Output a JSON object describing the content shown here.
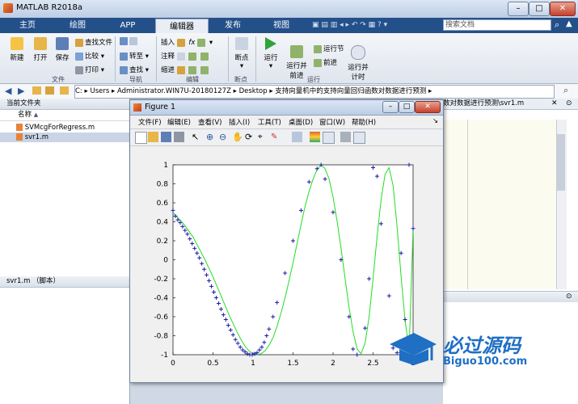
{
  "app": {
    "title": "MATLAB R2018a",
    "window_buttons": [
      "–",
      "□",
      "✕"
    ]
  },
  "tabs": [
    {
      "label": "主页"
    },
    {
      "label": "绘图"
    },
    {
      "label": "APP"
    },
    {
      "label": "编辑器",
      "active": true
    },
    {
      "label": "发布"
    },
    {
      "label": "视图"
    }
  ],
  "search": {
    "placeholder": "搜索文档"
  },
  "ribbon": {
    "file_group": "文件",
    "nav_group": "导航",
    "edit_group": "编辑",
    "breakpoint_group": "断点",
    "run_group": "运行",
    "new": "新建",
    "open": "打开",
    "save": "保存",
    "find_files": "查找文件",
    "compare": "比较",
    "print": "打印",
    "goto": "转至",
    "find": "查找",
    "insert": "插入",
    "comment": "注释",
    "indent": "缩进",
    "fx": "fx",
    "breakpoints": "断点",
    "run": "运行",
    "run_advance": "运行并\n前进",
    "run_section": "运行节",
    "advance": "前进",
    "run_time": "运行并\n计时"
  },
  "address": {
    "segments": [
      "C:",
      "Users",
      "Administrator.WIN7U-20180127Z",
      "Desktop",
      "支持向量机中的支持向量回归函数对数据进行预测"
    ]
  },
  "current_folder": {
    "header": "当前文件夹",
    "column_name": "名称",
    "column_sort": "▲",
    "files": [
      {
        "name": "SVMcgForRegress.m",
        "selected": false
      },
      {
        "name": "svr1.m",
        "selected": true
      }
    ],
    "details_header": "svr1.m （脚本）"
  },
  "editor_tab_text": "数对数据进行预测\\svr1.m",
  "figure": {
    "title": "Figure 1",
    "menus": [
      "文件(F)",
      "编辑(E)",
      "查看(V)",
      "插入(I)",
      "工具(T)",
      "桌面(D)",
      "窗口(W)",
      "帮助(H)"
    ]
  },
  "chart_data": {
    "type": "line",
    "title": "",
    "xlabel": "",
    "ylabel": "",
    "xlim": [
      0,
      3
    ],
    "ylim": [
      -1,
      1
    ],
    "xticks": [
      "0",
      "0.5",
      "1",
      "1.5",
      "2",
      "2.5",
      "3"
    ],
    "yticks": [
      "1",
      "0.8",
      "0.6",
      "0.4",
      "0.2",
      "0",
      "-0.2",
      "-0.4",
      "-0.6",
      "-0.8",
      "-1"
    ],
    "grid": false,
    "series": [
      {
        "style": "line",
        "color": "#22dd22",
        "x": [
          0,
          0.05,
          0.1,
          0.15,
          0.2,
          0.25,
          0.3,
          0.35,
          0.4,
          0.45,
          0.5,
          0.55,
          0.6,
          0.65,
          0.7,
          0.75,
          0.8,
          0.85,
          0.9,
          0.95,
          1.0,
          1.05,
          1.1,
          1.15,
          1.2,
          1.25,
          1.3,
          1.35,
          1.4,
          1.45,
          1.5,
          1.55,
          1.6,
          1.65,
          1.7,
          1.75,
          1.8,
          1.85,
          1.9,
          1.95,
          2.0,
          2.05,
          2.1,
          2.15,
          2.2,
          2.25,
          2.3,
          2.35,
          2.4,
          2.45,
          2.5,
          2.55,
          2.6,
          2.65,
          2.7,
          2.75,
          2.8,
          2.85,
          2.9,
          2.95,
          3.0
        ],
        "y": [
          0.5,
          0.45,
          0.41,
          0.36,
          0.3,
          0.24,
          0.16,
          0.08,
          0.0,
          -0.09,
          -0.18,
          -0.28,
          -0.38,
          -0.48,
          -0.58,
          -0.67,
          -0.76,
          -0.84,
          -0.91,
          -0.96,
          -0.99,
          -1.0,
          -0.99,
          -0.96,
          -0.9,
          -0.82,
          -0.7,
          -0.56,
          -0.4,
          -0.22,
          -0.03,
          0.17,
          0.37,
          0.56,
          0.72,
          0.85,
          0.95,
          1.0,
          0.96,
          0.85,
          0.66,
          0.41,
          0.12,
          -0.2,
          -0.5,
          -0.76,
          -0.94,
          -0.99,
          -0.88,
          -0.6,
          -0.2,
          0.24,
          0.63,
          0.9,
          0.97,
          0.78,
          0.35,
          -0.18,
          -0.64,
          -0.95,
          0.33
        ]
      },
      {
        "style": "markers",
        "marker": "+",
        "color": "#1a1aa8",
        "x": [
          0.0,
          0.03,
          0.06,
          0.09,
          0.12,
          0.15,
          0.18,
          0.21,
          0.24,
          0.27,
          0.3,
          0.33,
          0.36,
          0.39,
          0.42,
          0.45,
          0.48,
          0.51,
          0.54,
          0.57,
          0.6,
          0.63,
          0.66,
          0.69,
          0.72,
          0.75,
          0.78,
          0.81,
          0.84,
          0.87,
          0.9,
          0.93,
          0.96,
          0.99,
          1.02,
          1.05,
          1.08,
          1.11,
          1.14,
          1.17,
          1.2,
          1.25,
          1.3,
          1.4,
          1.5,
          1.6,
          1.7,
          1.8,
          1.85,
          1.9,
          2.0,
          2.1,
          2.2,
          2.25,
          2.3,
          2.4,
          2.45,
          2.5,
          2.55,
          2.6,
          2.7,
          2.75,
          2.8,
          2.85,
          2.9,
          2.95,
          3.0
        ],
        "y": [
          0.52,
          0.46,
          0.42,
          0.39,
          0.35,
          0.31,
          0.27,
          0.22,
          0.17,
          0.12,
          0.07,
          0.02,
          -0.04,
          -0.1,
          -0.16,
          -0.22,
          -0.28,
          -0.34,
          -0.4,
          -0.46,
          -0.52,
          -0.58,
          -0.63,
          -0.69,
          -0.74,
          -0.79,
          -0.84,
          -0.88,
          -0.92,
          -0.95,
          -0.97,
          -0.99,
          -1.0,
          -1.0,
          -0.99,
          -0.98,
          -0.95,
          -0.92,
          -0.87,
          -0.8,
          -0.73,
          -0.6,
          -0.45,
          -0.14,
          0.2,
          0.52,
          0.82,
          0.96,
          1.0,
          0.85,
          0.5,
          0.0,
          -0.6,
          -0.94,
          -1.0,
          -0.72,
          -0.2,
          0.97,
          0.88,
          0.38,
          -0.38,
          -0.93,
          -0.98,
          0.07,
          -0.63,
          1.0,
          0.33
        ]
      }
    ]
  },
  "watermark": {
    "text": "必过源码",
    "url_text": "Biguo100.com"
  }
}
